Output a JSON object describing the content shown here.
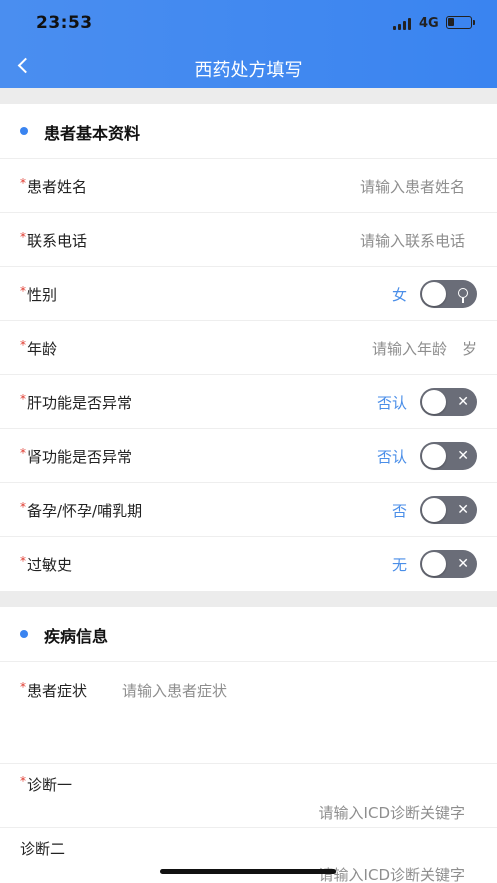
{
  "status_bar": {
    "time": "23:53",
    "network": "4G"
  },
  "header": {
    "title": "西药处方填写"
  },
  "sections": {
    "patient": {
      "title": "患者基本资料"
    },
    "disease": {
      "title": "疾病信息"
    }
  },
  "fields": {
    "name": {
      "label": "患者姓名",
      "placeholder": "请输入患者姓名"
    },
    "phone": {
      "label": "联系电话",
      "placeholder": "请输入联系电话"
    },
    "gender": {
      "label": "性别",
      "value": "女"
    },
    "age": {
      "label": "年龄",
      "placeholder": "请输入年龄",
      "unit": "岁"
    },
    "liver": {
      "label": "肝功能是否异常",
      "value": "否认"
    },
    "kidney": {
      "label": "肾功能是否异常",
      "value": "否认"
    },
    "pregnancy": {
      "label": "备孕/怀孕/哺乳期",
      "value": "否"
    },
    "allergy": {
      "label": "过敏史",
      "value": "无"
    },
    "symptom": {
      "label": "患者症状",
      "placeholder": "请输入患者症状"
    },
    "diagnosis1": {
      "label": "诊断一",
      "placeholder": "请输入ICD诊断关键字"
    },
    "diagnosis2": {
      "label": "诊断二",
      "placeholder": "请输入ICD诊断关键字"
    }
  },
  "required_mark": "*",
  "toggle_off_mark": "✕",
  "colors": {
    "accent": "#3a84f0",
    "value_text": "#4a8ee8",
    "required": "#e03c31",
    "toggle_track": "#6a6d78"
  }
}
